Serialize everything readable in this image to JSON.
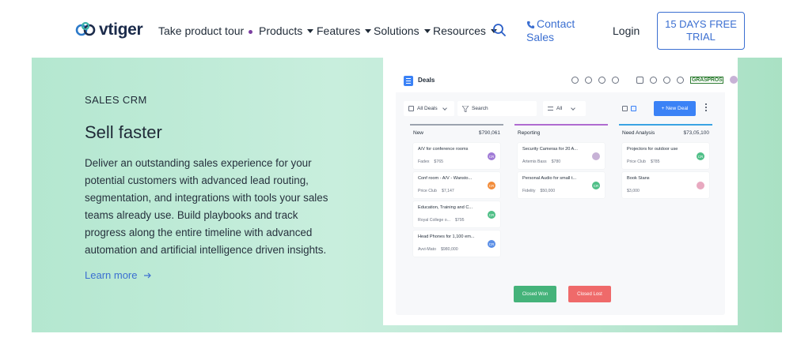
{
  "brand": {
    "name": "vtiger"
  },
  "nav": {
    "items": [
      {
        "label": "Take product tour",
        "has_dot": true
      },
      {
        "label": "Products",
        "has_caret": true
      },
      {
        "label": "Features",
        "has_caret": true
      },
      {
        "label": "Solutions",
        "has_caret": true
      },
      {
        "label": "Resources",
        "has_caret": true
      }
    ],
    "search_icon": "search-icon",
    "contact_line1": "Contact",
    "contact_line2": "Sales",
    "login": "Login",
    "trial_line1": "15 DAYS FREE",
    "trial_line2": "TRIAL",
    "accent": "#3b6fd1"
  },
  "hero": {
    "eyebrow": "SALES CRM",
    "headline": "Sell faster",
    "description": "Deliver an outstanding sales experience for your potential customers with advanced lead routing, segmentation, and integrations with tools your sales teams already use. Build playbooks and track progress along the entire timeline with advanced automation and artificial intelligence driven insights.",
    "learn_more": "Learn more",
    "learn_icon": "arrow-right-icon"
  },
  "app": {
    "title": "Deals",
    "brand_badge": "GRASPROS",
    "filter_label": "All Deals",
    "search_label": "Search",
    "view_label": "All",
    "new_deal": "+ New Deal",
    "columns": [
      {
        "name": "New",
        "amount": "$790,061",
        "color": "#9ca3af",
        "cards": [
          {
            "title": "A/V for conference rooms",
            "org": "Fadex",
            "amount": "$765",
            "avatar": "CR",
            "avatar_color": "#a07ad6"
          },
          {
            "title": "Conf room - A/V - Wansto...",
            "org": "Price Club",
            "amount": "$7,147",
            "avatar": "CR",
            "avatar_color": "#f28c3a"
          },
          {
            "title": "Education, Training and C...",
            "org": "Royal College o...",
            "amount": "$795",
            "avatar": "CR",
            "avatar_color": "#4fbf87"
          },
          {
            "title": "Head Phones for 1,100 em...",
            "org": "Avvi-Mato",
            "amount": "$980,000",
            "avatar": "CR",
            "avatar_color": "#5b8fe6"
          }
        ]
      },
      {
        "name": "Reporting",
        "amount": "",
        "color": "#b06bd0",
        "cards": [
          {
            "title": "Security Cameras for 20 A...",
            "org": "Artemis Bass",
            "amount": "$780",
            "avatar": "",
            "avatar_color": "#c7b2d6"
          },
          {
            "title": "Personal Audio for small t...",
            "org": "Fidelity",
            "amount": "$50,000",
            "avatar": "CR",
            "avatar_color": "#4fbf87"
          }
        ]
      },
      {
        "name": "Need Analysis",
        "amount": "$73,05,100",
        "color": "#3aa3e3",
        "cards": [
          {
            "title": "Projectors for outdoor use",
            "org": "Price Club",
            "amount": "$785",
            "avatar": "CR",
            "avatar_color": "#4fbf87"
          },
          {
            "title": "Book Stans",
            "org": "$3,000",
            "amount": "",
            "avatar": "",
            "avatar_color": "#e8a9c0"
          }
        ]
      }
    ],
    "won_label": "Closed Won",
    "lost_label": "Closed Lost"
  }
}
